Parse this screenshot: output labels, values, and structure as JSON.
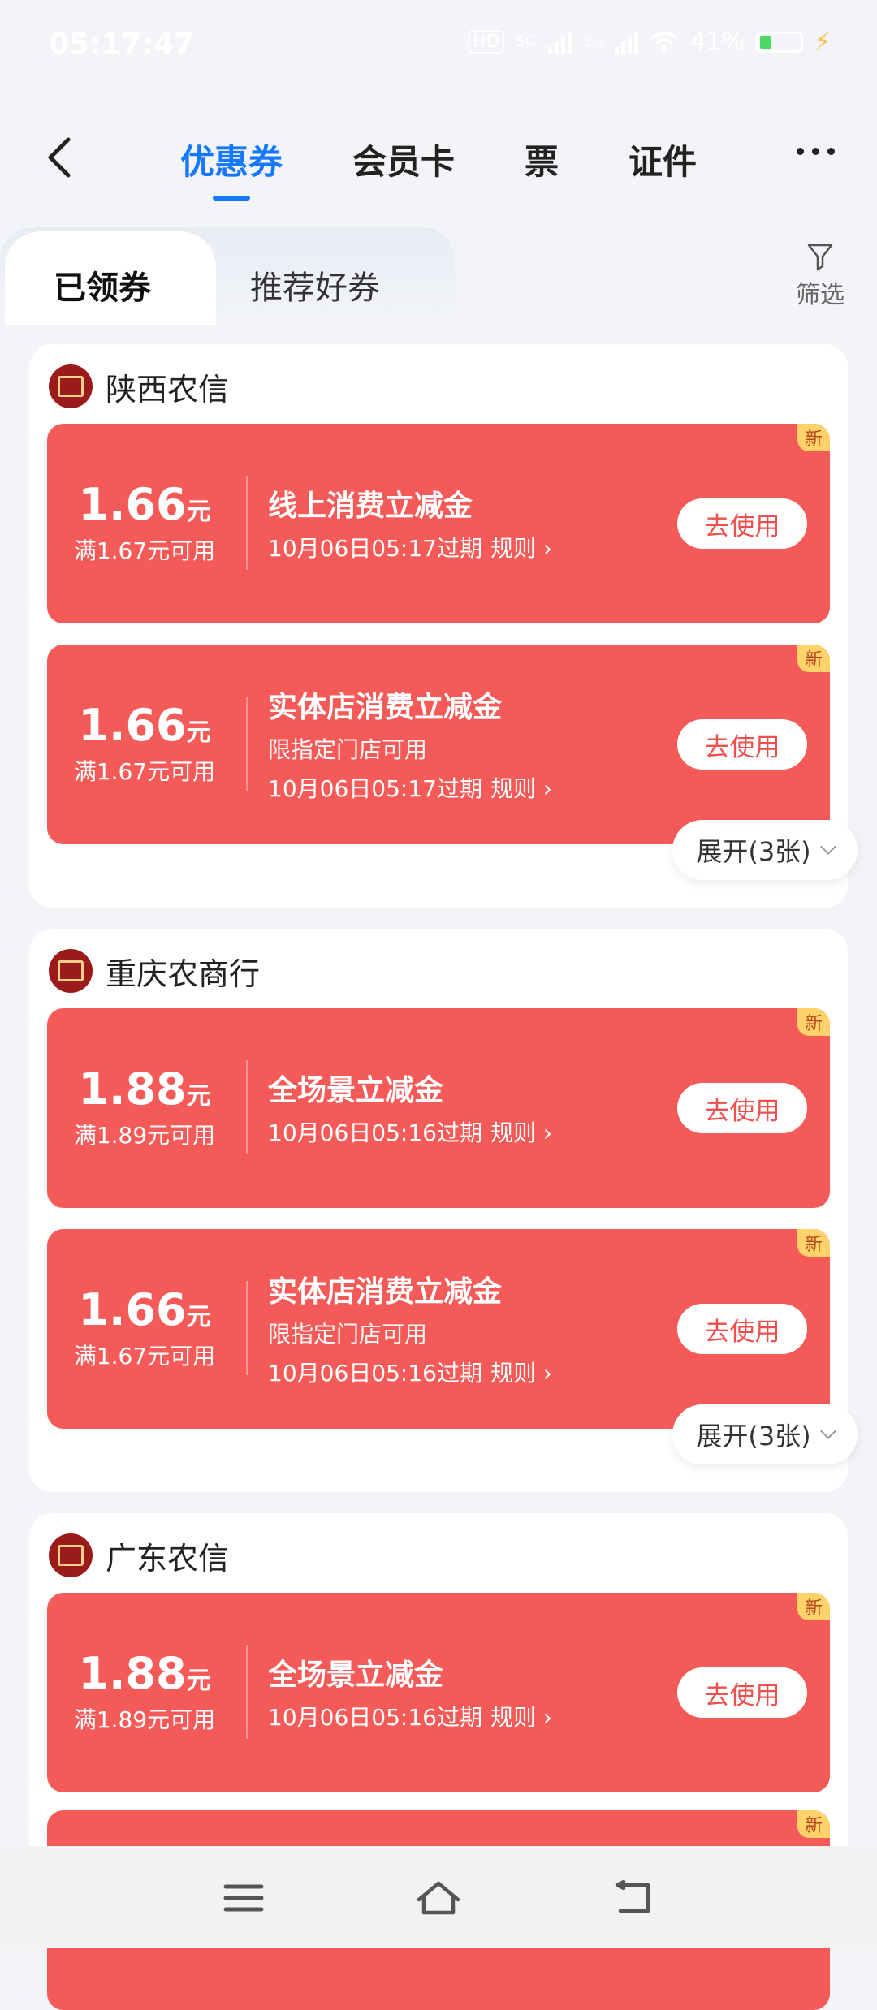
{
  "status_bar": {
    "time": "05:17:47",
    "network_label_1": "HD",
    "network_label_2": "5G",
    "network_label_3": "5G",
    "battery_percent": "41%"
  },
  "topnav": {
    "tabs": [
      {
        "label": "优惠券",
        "active": true
      },
      {
        "label": "会员卡",
        "active": false
      },
      {
        "label": "票",
        "active": false
      },
      {
        "label": "证件",
        "active": false
      }
    ]
  },
  "subtabs": {
    "items": [
      {
        "label": "已领券",
        "active": true
      },
      {
        "label": "推荐好券",
        "active": false
      }
    ],
    "filter_label": "筛选"
  },
  "groups": [
    {
      "bank": "陕西农信",
      "coupons": [
        {
          "amount": "1.66",
          "unit": "元",
          "condition": "满1.67元可用",
          "title": "线上消费立减金",
          "subtitle": "",
          "expiry": "10月06日05:17过期",
          "rule": "规则",
          "button": "去使用",
          "badge": "新"
        },
        {
          "amount": "1.66",
          "unit": "元",
          "condition": "满1.67元可用",
          "title": "实体店消费立减金",
          "subtitle": "限指定门店可用",
          "expiry": "10月06日05:17过期",
          "rule": "规则",
          "button": "去使用",
          "badge": "新"
        }
      ],
      "expand_label": "展开(3张)"
    },
    {
      "bank": "重庆农商行",
      "coupons": [
        {
          "amount": "1.88",
          "unit": "元",
          "condition": "满1.89元可用",
          "title": "全场景立减金",
          "subtitle": "",
          "expiry": "10月06日05:16过期",
          "rule": "规则",
          "button": "去使用",
          "badge": "新"
        },
        {
          "amount": "1.66",
          "unit": "元",
          "condition": "满1.67元可用",
          "title": "实体店消费立减金",
          "subtitle": "限指定门店可用",
          "expiry": "10月06日05:16过期",
          "rule": "规则",
          "button": "去使用",
          "badge": "新"
        }
      ],
      "expand_label": "展开(3张)"
    },
    {
      "bank": "广东农信",
      "coupons": [
        {
          "amount": "1.88",
          "unit": "元",
          "condition": "满1.89元可用",
          "title": "全场景立减金",
          "subtitle": "",
          "expiry": "10月06日05:16过期",
          "rule": "规则",
          "button": "去使用",
          "badge": "新"
        },
        {
          "badge": "新"
        }
      ]
    }
  ],
  "colors": {
    "accent_blue": "#1677ff",
    "coupon_red": "#f45b58",
    "badge_yellow": "#ffd36a"
  }
}
